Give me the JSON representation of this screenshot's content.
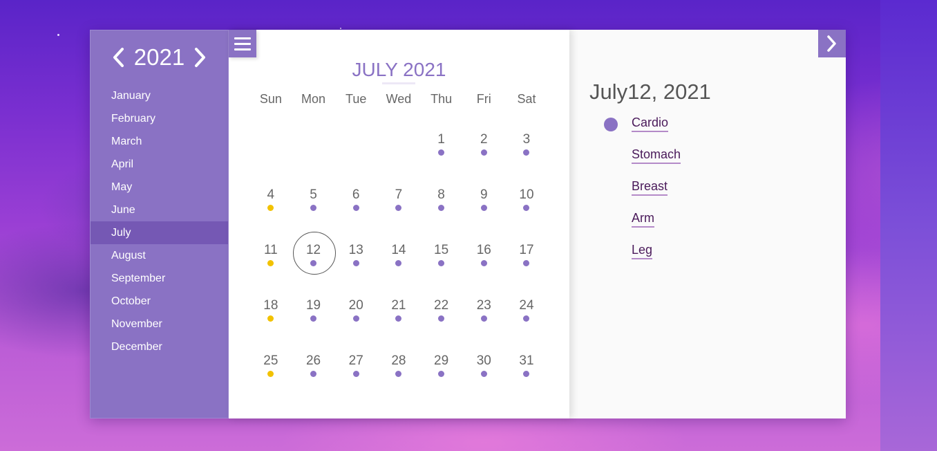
{
  "year": {
    "label": "2021"
  },
  "months": [
    "January",
    "February",
    "March",
    "April",
    "May",
    "June",
    "July",
    "August",
    "September",
    "October",
    "November",
    "December"
  ],
  "active_month_index": 6,
  "calendar": {
    "title": "JULY 2021",
    "weekdays": [
      "Sun",
      "Mon",
      "Tue",
      "Wed",
      "Thu",
      "Fri",
      "Sat"
    ],
    "weeks": [
      [
        null,
        null,
        null,
        null,
        "1",
        "2",
        "3"
      ],
      [
        "4",
        "5",
        "6",
        "7",
        "8",
        "9",
        "10"
      ],
      [
        "11",
        "12",
        "13",
        "14",
        "15",
        "16",
        "17"
      ],
      [
        "18",
        "19",
        "20",
        "21",
        "22",
        "23",
        "24"
      ],
      [
        "25",
        "26",
        "27",
        "28",
        "29",
        "30",
        "31"
      ]
    ],
    "selected_day": "12",
    "yellow_days": [
      "4",
      "11",
      "18",
      "25"
    ]
  },
  "detail": {
    "date": "July12, 2021",
    "workouts": [
      {
        "label": "Cardio",
        "marked": true
      },
      {
        "label": "Stomach",
        "marked": false
      },
      {
        "label": "Breast",
        "marked": false
      },
      {
        "label": "Arm",
        "marked": false
      },
      {
        "label": "Leg",
        "marked": false
      }
    ]
  },
  "colors": {
    "accent": "#8a72c4",
    "accent_dark": "#7558b4",
    "event_dot": "#8a72c4",
    "highlight_dot": "#f2c200"
  },
  "icons": {
    "prev_year": "chevron-left-icon",
    "next_year": "chevron-right-icon",
    "menu": "hamburger-menu-icon",
    "next_panel": "chevron-right-icon"
  }
}
